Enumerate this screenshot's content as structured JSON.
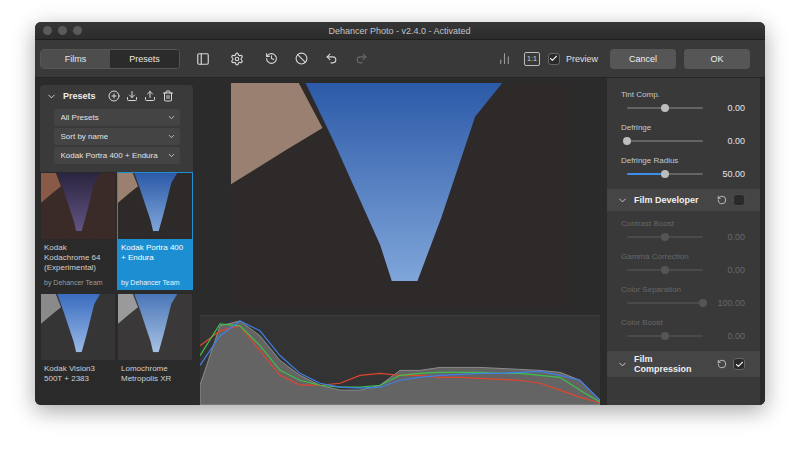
{
  "window": {
    "title": "Dehancer Photo - v2.4.0 - Activated"
  },
  "toolbar": {
    "tabs": [
      {
        "label": "Films",
        "selected": false
      },
      {
        "label": "Presets",
        "selected": true
      }
    ],
    "zoom": "1:1",
    "preview": {
      "label": "Preview",
      "checked": true
    },
    "buttons": [
      "Cancel",
      "OK"
    ]
  },
  "presets_panel": {
    "title": "Presets",
    "expanded": true,
    "dropdowns": [
      "All Presets",
      "Sort by name",
      "Kodak Portra 400 + Endura"
    ],
    "items": [
      {
        "name": "Kodak Kodachrome 64 (Experimental)",
        "author": "by Dehancer Team",
        "selected": false
      },
      {
        "name": "Kodak Portra 400 + Endura",
        "author": "by Dehancer Team",
        "selected": true
      },
      {
        "name": "Kodak Vision3 500T + 2383",
        "selected": false
      },
      {
        "name": "Lomochrome Metropolis XR",
        "selected": false
      }
    ]
  },
  "histogram": {
    "series": [
      {
        "name": "luma",
        "color": "#8c8c8c",
        "values": [
          20,
          80,
          85,
          70,
          45,
          30,
          20,
          15,
          15,
          20,
          35,
          35,
          38,
          38,
          38,
          37,
          36,
          35,
          33,
          25,
          5
        ]
      },
      {
        "name": "red",
        "color": "#e0452f",
        "values": [
          60,
          75,
          80,
          55,
          30,
          20,
          20,
          22,
          30,
          32,
          30,
          30,
          28,
          28,
          27,
          26,
          25,
          22,
          15,
          8,
          2
        ]
      },
      {
        "name": "green",
        "color": "#3fbf4a",
        "values": [
          50,
          82,
          80,
          60,
          35,
          25,
          20,
          18,
          18,
          20,
          30,
          32,
          33,
          33,
          33,
          32,
          32,
          30,
          28,
          15,
          3
        ]
      },
      {
        "name": "blue",
        "color": "#3f7fe6",
        "values": [
          40,
          70,
          85,
          75,
          50,
          32,
          22,
          18,
          17,
          18,
          25,
          28,
          30,
          31,
          32,
          32,
          33,
          34,
          30,
          25,
          5
        ]
      }
    ]
  },
  "adjustments": {
    "sliders": [
      {
        "label": "Tint Comp.",
        "kind": "bipolar",
        "level": 0.5,
        "value": "0.00"
      },
      {
        "label": "Defringe",
        "kind": "range",
        "level": 0,
        "value": "0.00"
      },
      {
        "label": "Defringe Radius",
        "kind": "range",
        "level": 0.5,
        "value": "50.00"
      }
    ],
    "sections": [
      {
        "title": "Film Developer",
        "expanded": true,
        "enabled": false,
        "sliders": [
          {
            "label": "Contrast Boost",
            "kind": "bipolar",
            "level": 0.5,
            "value": "0.00"
          },
          {
            "label": "Gamma Correction",
            "kind": "bipolar",
            "level": 0.5,
            "value": "0.00"
          },
          {
            "label": "Color Separation",
            "kind": "range",
            "level": 1,
            "value": "100.00"
          },
          {
            "label": "Color Boost",
            "kind": "bipolar",
            "level": 0.5,
            "value": "0.00"
          }
        ]
      },
      {
        "title": "Film Compression",
        "expanded": true,
        "enabled": true,
        "sliders": []
      }
    ]
  }
}
